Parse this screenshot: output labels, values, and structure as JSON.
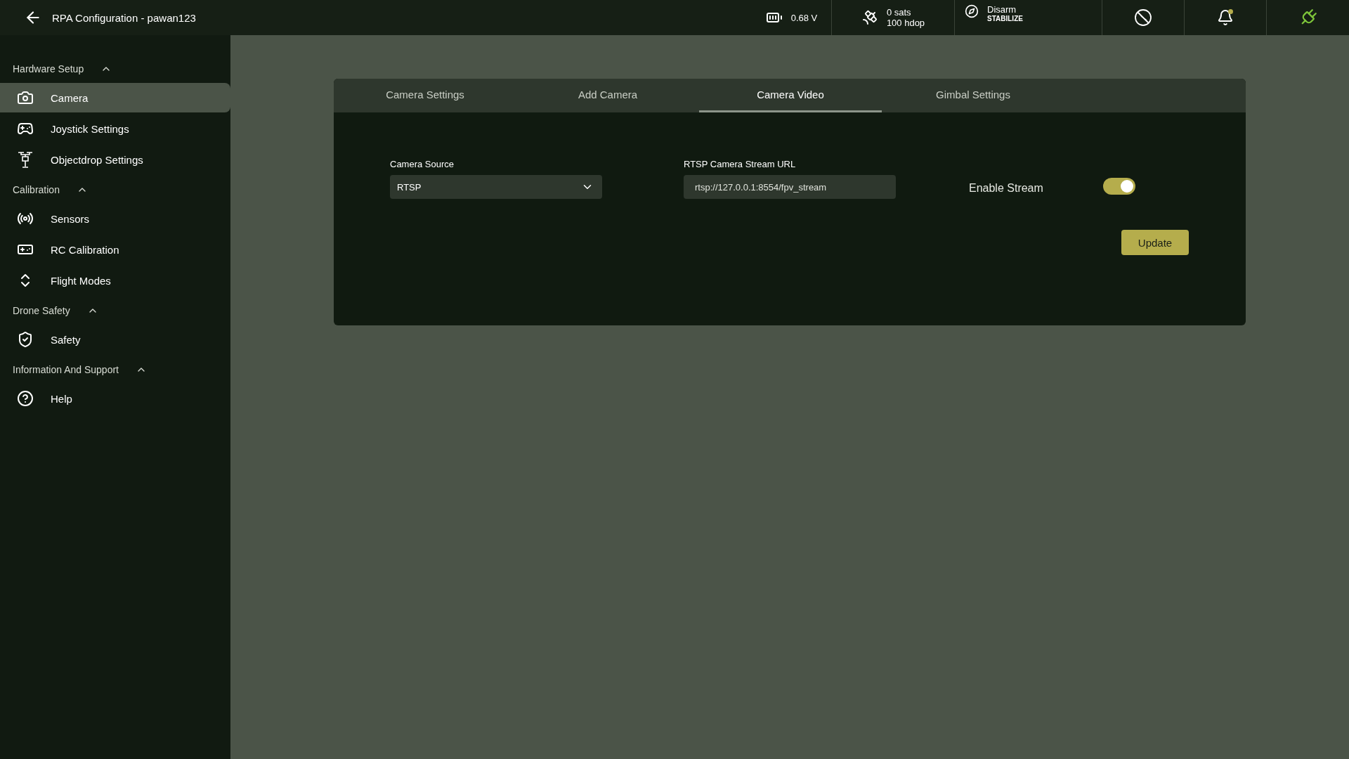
{
  "header": {
    "title": "RPA Configuration - pawan123",
    "battery": "0.68 V",
    "gps": {
      "sats": "0 sats",
      "hdop": "100 hdop"
    },
    "arm": {
      "state": "Disarm",
      "mode": "STABILIZE"
    },
    "connected": true
  },
  "sidebar": [
    {
      "title": "Hardware Setup",
      "expanded": true,
      "items": [
        {
          "kind": "camera",
          "label": "Camera",
          "selected": true
        },
        {
          "kind": "joystick",
          "label": "Joystick Settings",
          "selected": false
        },
        {
          "kind": "drone",
          "label": "Objectdrop Settings",
          "selected": false
        }
      ]
    },
    {
      "title": "Calibration",
      "expanded": true,
      "items": [
        {
          "kind": "sensor",
          "label": "Sensors",
          "selected": false
        },
        {
          "kind": "gamepad",
          "label": "RC Calibration",
          "selected": false
        },
        {
          "kind": "modes",
          "label": "Flight Modes",
          "selected": false
        }
      ]
    },
    {
      "title": "Drone Safety",
      "expanded": true,
      "items": [
        {
          "kind": "shield",
          "label": "Safety",
          "selected": false
        }
      ]
    },
    {
      "title": "Information And Support",
      "expanded": true,
      "items": [
        {
          "kind": "help",
          "label": "Help",
          "selected": false
        }
      ]
    }
  ],
  "tabs": [
    {
      "label": "Camera Settings",
      "selected": false
    },
    {
      "label": "Add Camera",
      "selected": false
    },
    {
      "label": "Camera Video",
      "selected": true
    },
    {
      "label": "Gimbal Settings",
      "selected": false
    }
  ],
  "form": {
    "camera_source": {
      "label": "Camera Source",
      "value": "RTSP"
    },
    "stream_url": {
      "label": "RTSP Camera Stream URL",
      "value": "rtsp://127.0.0.1:8554/fpv_stream"
    },
    "enable_stream": {
      "label": "Enable Stream",
      "on": true
    },
    "update_button": "Update"
  }
}
